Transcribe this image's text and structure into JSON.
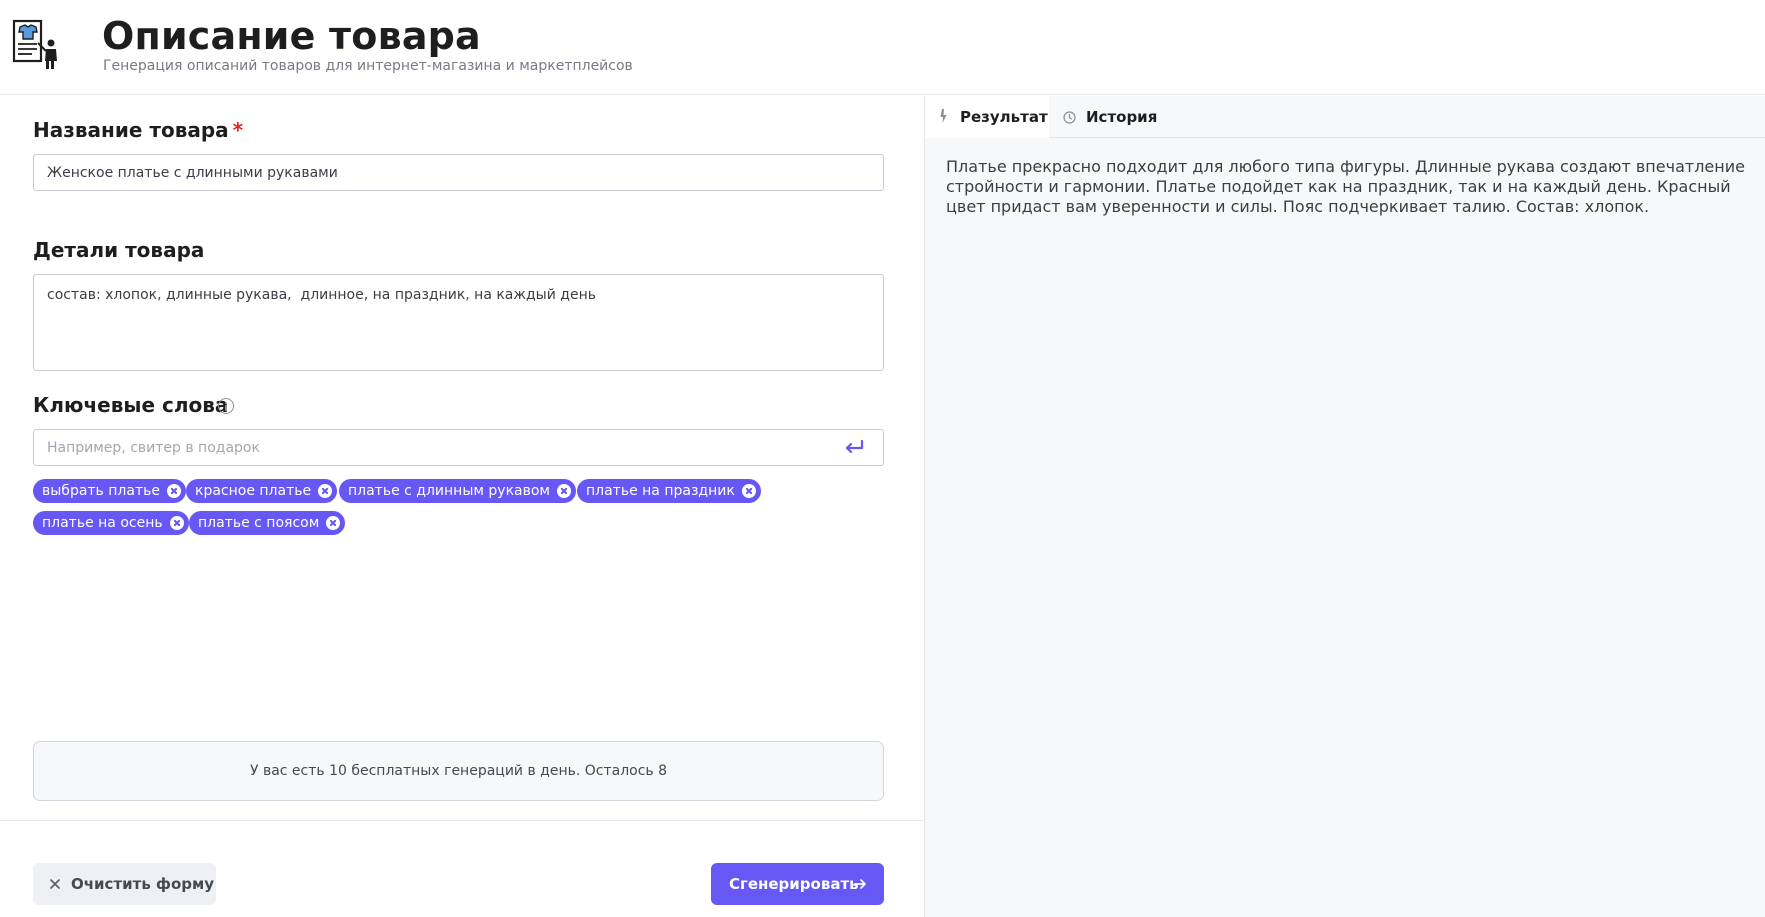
{
  "header": {
    "title": "Описание товара",
    "subtitle": "Генерация описаний товаров для интернет-магазина и маркетплейсов",
    "logo_icon": "product-description-icon"
  },
  "form": {
    "name": {
      "label": "Название товара",
      "required_mark": "*",
      "value": "Женское платье с длинными рукавами"
    },
    "details": {
      "label": "Детали товара",
      "value": "состав: хлопок, длинные рукава,  длинное, на праздник, на каждый день"
    },
    "keywords": {
      "label": "Ключевые слова",
      "placeholder": "Например, свитер в подарок",
      "value": "",
      "chips": [
        "выбрать платье",
        "красное платье",
        "платье с длинным рукавом",
        "платье на праздник",
        "платье на осень",
        "платье с поясом"
      ]
    },
    "notice": "У вас есть 10 бесплатных генераций в день. Осталось 8"
  },
  "actions": {
    "clear_label": "Очистить форму",
    "generate_label": "Сгенерировать"
  },
  "panel": {
    "tabs": [
      {
        "label": "Результат",
        "icon": "lightning-icon"
      },
      {
        "label": "История",
        "icon": "clock-icon"
      }
    ],
    "result_text": "Платье прекрасно подходит для любого типа фигуры. Длинные рукава создают впечатление стройности и гармонии. Платье подойдет как на праздник, так и на каждый день. Красный цвет придаст вам уверенности и силы. Пояс подчеркивает талию. Состав: хлопок."
  },
  "colors": {
    "accent": "#6757f5",
    "required": "#e0241b",
    "panel_bg": "#f7f8fa"
  }
}
